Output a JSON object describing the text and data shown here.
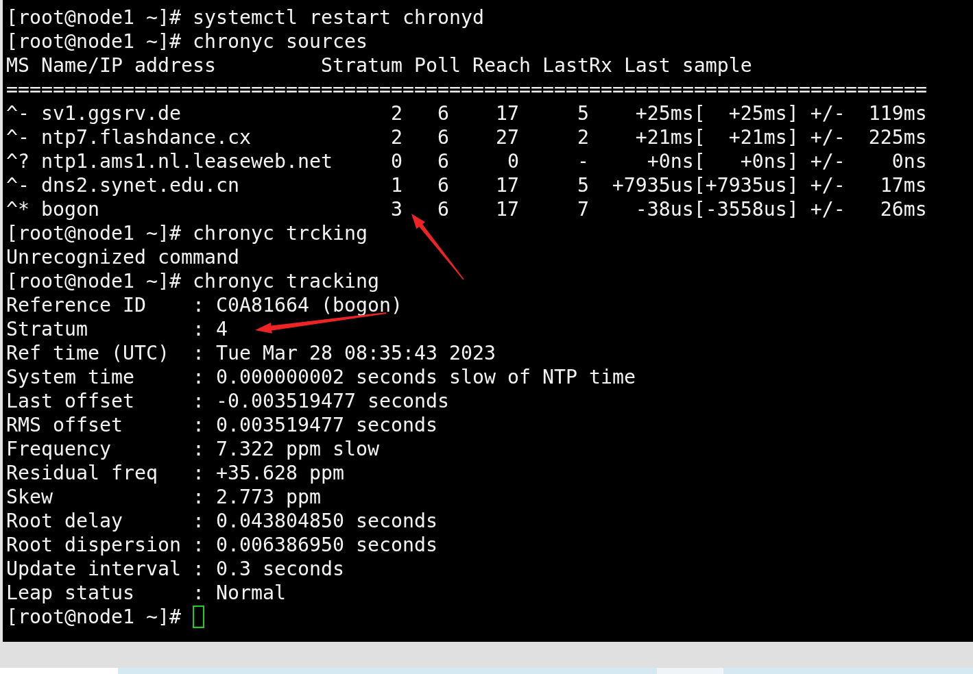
{
  "terminal": {
    "blocks": [
      {
        "kind": "command",
        "prompt": "[root@node1 ~]#",
        "command": "systemctl restart chronyd",
        "cursor": false
      },
      {
        "kind": "command",
        "prompt": "[root@node1 ~]#",
        "command": "chronyc sources",
        "cursor": false
      },
      {
        "kind": "sources",
        "columns": [
          "MS",
          "Name/IP address",
          "Stratum",
          "Poll",
          "Reach",
          "LastRx",
          "Last sample"
        ],
        "rule": "===============================================================================",
        "rows": [
          {
            "mode": "^-",
            "name": "sv1.ggsrv.de",
            "stratum": "2",
            "poll": "6",
            "reach": "17",
            "last_rx": "5",
            "last_sample": "+25ms[  +25ms] +/-  119ms"
          },
          {
            "mode": "^-",
            "name": "ntp7.flashdance.cx",
            "stratum": "2",
            "poll": "6",
            "reach": "27",
            "last_rx": "2",
            "last_sample": "+21ms[  +21ms] +/-  225ms"
          },
          {
            "mode": "^?",
            "name": "ntp1.ams1.nl.leaseweb.net",
            "stratum": "0",
            "poll": "6",
            "reach": "0",
            "last_rx": "-",
            "last_sample": "+0ns[   +0ns] +/-    0ns"
          },
          {
            "mode": "^-",
            "name": "dns2.synet.edu.cn",
            "stratum": "1",
            "poll": "6",
            "reach": "17",
            "last_rx": "5",
            "last_sample": "+7935us[+7935us] +/-   17ms"
          },
          {
            "mode": "^*",
            "name": "bogon",
            "stratum": "3",
            "poll": "6",
            "reach": "17",
            "last_rx": "7",
            "last_sample": "-38us[-3558us] +/-   26ms"
          }
        ]
      },
      {
        "kind": "command",
        "prompt": "[root@node1 ~]#",
        "command": "chronyc trcking",
        "cursor": false
      },
      {
        "kind": "output",
        "text": "Unrecognized command"
      },
      {
        "kind": "command",
        "prompt": "[root@node1 ~]#",
        "command": "chronyc tracking",
        "cursor": false
      },
      {
        "kind": "fields",
        "separator": ":",
        "items": [
          {
            "label": "Reference ID",
            "value": "C0A81664 (bogon)"
          },
          {
            "label": "Stratum",
            "value": "4"
          },
          {
            "label": "Ref time (UTC)",
            "value": "Tue Mar 28 08:35:43 2023"
          },
          {
            "label": "System time",
            "value": "0.000000002 seconds slow of NTP time"
          },
          {
            "label": "Last offset",
            "value": "-0.003519477 seconds"
          },
          {
            "label": "RMS offset",
            "value": "0.003519477 seconds"
          },
          {
            "label": "Frequency",
            "value": "7.322 ppm slow"
          },
          {
            "label": "Residual freq",
            "value": "+35.628 ppm"
          },
          {
            "label": "Skew",
            "value": "2.773 ppm"
          },
          {
            "label": "Root delay",
            "value": "0.043804850 seconds"
          },
          {
            "label": "Root dispersion",
            "value": "0.006386950 seconds"
          },
          {
            "label": "Update interval",
            "value": "0.3 seconds"
          },
          {
            "label": "Leap status",
            "value": "Normal"
          }
        ]
      },
      {
        "kind": "command",
        "prompt": "[root@node1 ~]#",
        "cursor": true
      }
    ]
  }
}
